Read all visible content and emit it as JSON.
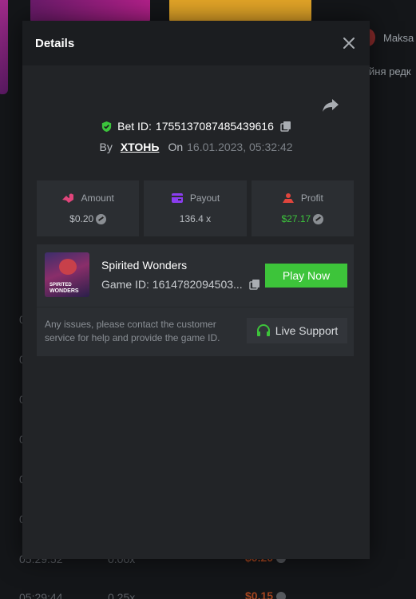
{
  "background": {
    "user": "Maksa",
    "side_text": "йня редк",
    "rows": [
      {
        "time": "05:29:52",
        "mult": "0.00x",
        "amount": "$0.20"
      },
      {
        "time": "05:29:44",
        "mult": "0.25x",
        "amount": "$0.15"
      }
    ]
  },
  "modal": {
    "title": "Details",
    "bet_label": "Bet ID:",
    "bet_id": "1755137087485439616",
    "by_label": "By",
    "user": "ХТОНЬ",
    "on_label": "On",
    "date": "16.01.2023, 05:32:42",
    "stats": {
      "amount_label": "Amount",
      "amount_value": "$0.20",
      "payout_label": "Payout",
      "payout_value": "136.4 x",
      "profit_label": "Profit",
      "profit_value": "$27.17"
    },
    "game": {
      "name": "Spirited Wonders",
      "id_text": "Game ID: 1614782094503...",
      "thumb_line1": "SPIRITED",
      "thumb_line2": "WONDERS",
      "play_label": "Play Now"
    },
    "help_text": "Any issues, please contact the customer service for help and provide the game ID.",
    "support_label": "Live Support"
  },
  "colors": {
    "accent_green": "#3dc43a",
    "profit_green": "#3cc43c",
    "amount_icon": "#e0457b",
    "payout_icon": "#8b3df0",
    "profit_icon": "#e0453d"
  }
}
